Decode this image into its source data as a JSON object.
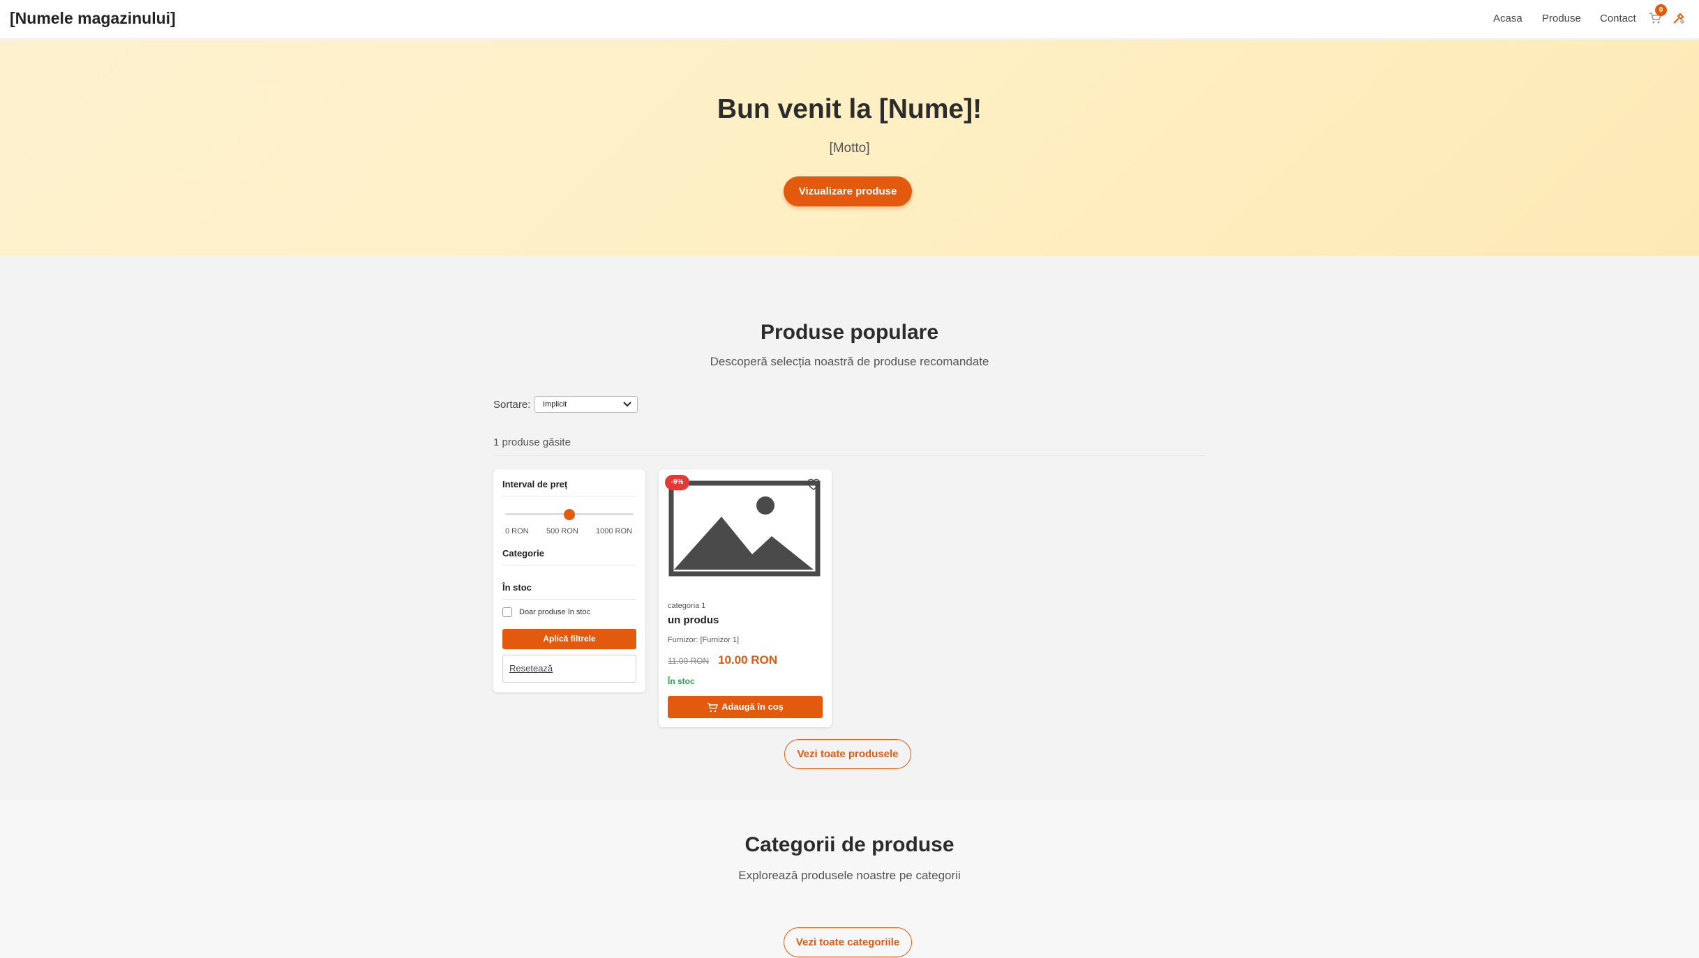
{
  "header": {
    "brand": "[Numele magazinului]",
    "nav": [
      "Acasa",
      "Produse",
      "Contact"
    ],
    "cart_count": "0"
  },
  "hero": {
    "title": "Bun venit la [Nume]!",
    "motto": "[Motto]",
    "button": "Vizualizare produse"
  },
  "popular": {
    "title": "Produse populare",
    "subtitle": "Descoperă selecția noastră de produse recomandate",
    "sort_label": "Sortare:",
    "sort_value": "Implicit",
    "found": "1 produse găsite",
    "view_all": "Vezi toate produsele"
  },
  "filters": {
    "price_title": "Interval de preț",
    "price_value": 500,
    "price_min": "0 RON",
    "price_mid": "500 RON",
    "price_max": "1000 RON",
    "category_title": "Categorie",
    "stock_title": "În stoc",
    "stock_checkbox": "Doar produse în stoc",
    "apply": "Aplică filtrele",
    "reset": "Resetează"
  },
  "product": {
    "discount": "-9%",
    "category": "categoria 1",
    "name": "un produs",
    "supplier": "Furnizor: [Furnizor 1]",
    "old_price": "11.00 RON",
    "new_price": "10.00 RON",
    "stock": "În stoc",
    "add_to_cart": "Adaugă în coș"
  },
  "categories": {
    "title": "Categorii de produse",
    "subtitle": "Explorează produsele noastre pe categorii",
    "view_all": "Vezi toate categoriile"
  },
  "colors": {
    "accent": "#e35a0e",
    "discount": "#e53935",
    "in_stock": "#2e9e4f"
  }
}
